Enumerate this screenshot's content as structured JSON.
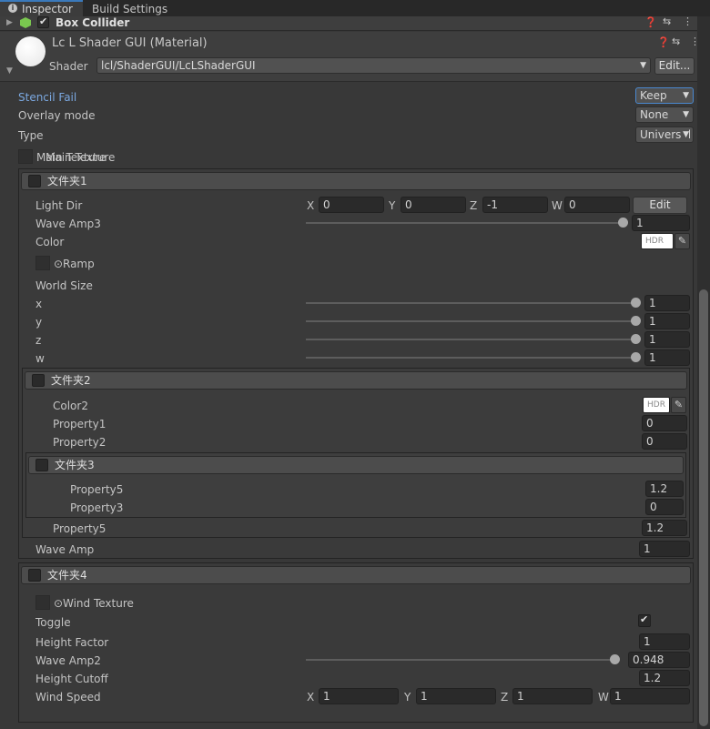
{
  "tabs": [
    {
      "label": "Inspector",
      "active": true
    },
    {
      "label": "Build Settings",
      "active": false
    }
  ],
  "component": {
    "title": "Box Collider"
  },
  "material": {
    "title": "Lc L Shader GUI (Material)",
    "shader_label": "Shader",
    "shader_value": "lcl/ShaderGUI/LcLShaderGUI",
    "edit_label": "Edit..."
  },
  "props": {
    "stencil_fail": {
      "label": "Stencil Fail",
      "value": "Keep"
    },
    "overlay_mode": {
      "label": "Overlay mode",
      "value": "None"
    },
    "type": {
      "label": "Type",
      "value": "Universal"
    },
    "main_texture": "Main Texture"
  },
  "folder1": {
    "title": "文件夹1",
    "light_dir": {
      "label": "Light Dir",
      "x_label": "X",
      "x": "0",
      "y_label": "Y",
      "y": "0",
      "z_label": "Z",
      "z": "-1",
      "w_label": "W",
      "w": "0",
      "edit": "Edit"
    },
    "wave_amp3": {
      "label": "Wave Amp3",
      "value": "1",
      "fraction": 1.0
    },
    "color": {
      "label": "Color",
      "hdr": "HDR"
    },
    "ramp": "Ramp",
    "world_size": "World Size",
    "sliders": [
      {
        "label": "x",
        "value": "1"
      },
      {
        "label": "y",
        "value": "1"
      },
      {
        "label": "z",
        "value": "1"
      },
      {
        "label": "w",
        "value": "1"
      }
    ],
    "folder2": {
      "title": "文件夹2",
      "color2": {
        "label": "Color2",
        "hdr": "HDR"
      },
      "property1": {
        "label": "Property1",
        "value": "0"
      },
      "property2": {
        "label": "Property2",
        "value": "0"
      },
      "folder3": {
        "title": "文件夹3",
        "property5": {
          "label": "Property5",
          "value": "1.2"
        },
        "property3": {
          "label": "Property3",
          "value": "0"
        }
      },
      "property5": {
        "label": "Property5",
        "value": "1.2"
      }
    },
    "wave_amp": {
      "label": "Wave Amp",
      "value": "1"
    }
  },
  "folder4": {
    "title": "文件夹4",
    "wind_texture": "Wind Texture",
    "toggle": {
      "label": "Toggle",
      "checked": true
    },
    "height_factor": {
      "label": "Height Factor",
      "value": "1"
    },
    "wave_amp2": {
      "label": "Wave Amp2",
      "value": "0.948",
      "fraction": 0.948
    },
    "height_cutoff": {
      "label": "Height Cutoff",
      "value": "1.2"
    },
    "wind_speed": {
      "label": "Wind Speed",
      "x_label": "X",
      "x": "1",
      "y_label": "Y",
      "y": "1",
      "z_label": "Z",
      "z": "1",
      "w_label": "W",
      "w": "1"
    }
  }
}
